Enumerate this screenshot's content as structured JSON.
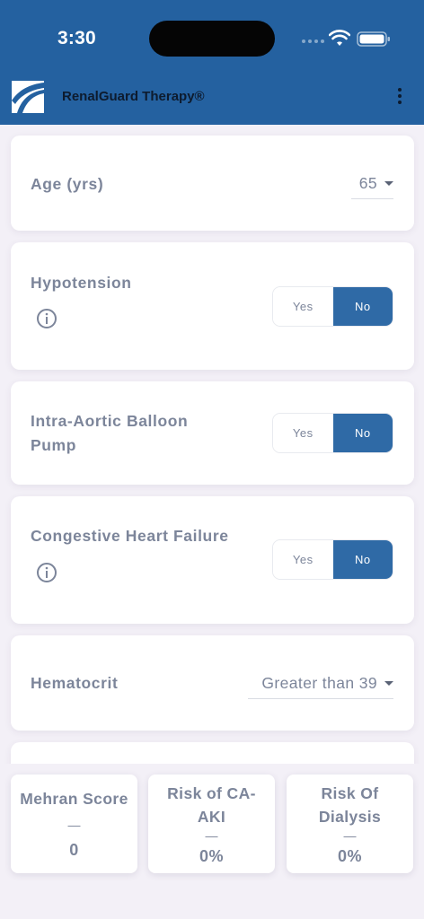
{
  "status_bar": {
    "time": "3:30"
  },
  "header": {
    "title": "RenalGuard Therapy®"
  },
  "fields": {
    "age": {
      "label": "Age (yrs)",
      "value": "65"
    },
    "hypotension": {
      "label": "Hypotension",
      "yes": "Yes",
      "no": "No",
      "selected": "No"
    },
    "iabp": {
      "label_line1": "Intra-Aortic Balloon",
      "label_line2": "Pump",
      "yes": "Yes",
      "no": "No",
      "selected": "No"
    },
    "chf": {
      "label": "Congestive Heart Failure",
      "yes": "Yes",
      "no": "No",
      "selected": "No"
    },
    "hematocrit": {
      "label": "Hematocrit",
      "value": "Greater than 39"
    }
  },
  "results": {
    "mehran": {
      "title": "Mehran Score",
      "dash": "—",
      "value": "0"
    },
    "risk_ca_aki": {
      "title_line1": "Risk of CA-",
      "title_line2": "AKI",
      "dash": "—",
      "value": "0%"
    },
    "risk_dialysis": {
      "title_line1": "Risk Of",
      "title_line2": "Dialysis",
      "dash": "—",
      "value": "0%"
    }
  },
  "icons": {
    "info": "info-icon",
    "logo": "app-logo",
    "more": "more-vert-icon",
    "wifi": "wifi-icon",
    "battery": "battery-icon",
    "caret": "caret-down-icon"
  },
  "colors": {
    "header": "#2461a0",
    "toggle_selected": "#2f6aa6",
    "label": "#7c859a"
  }
}
